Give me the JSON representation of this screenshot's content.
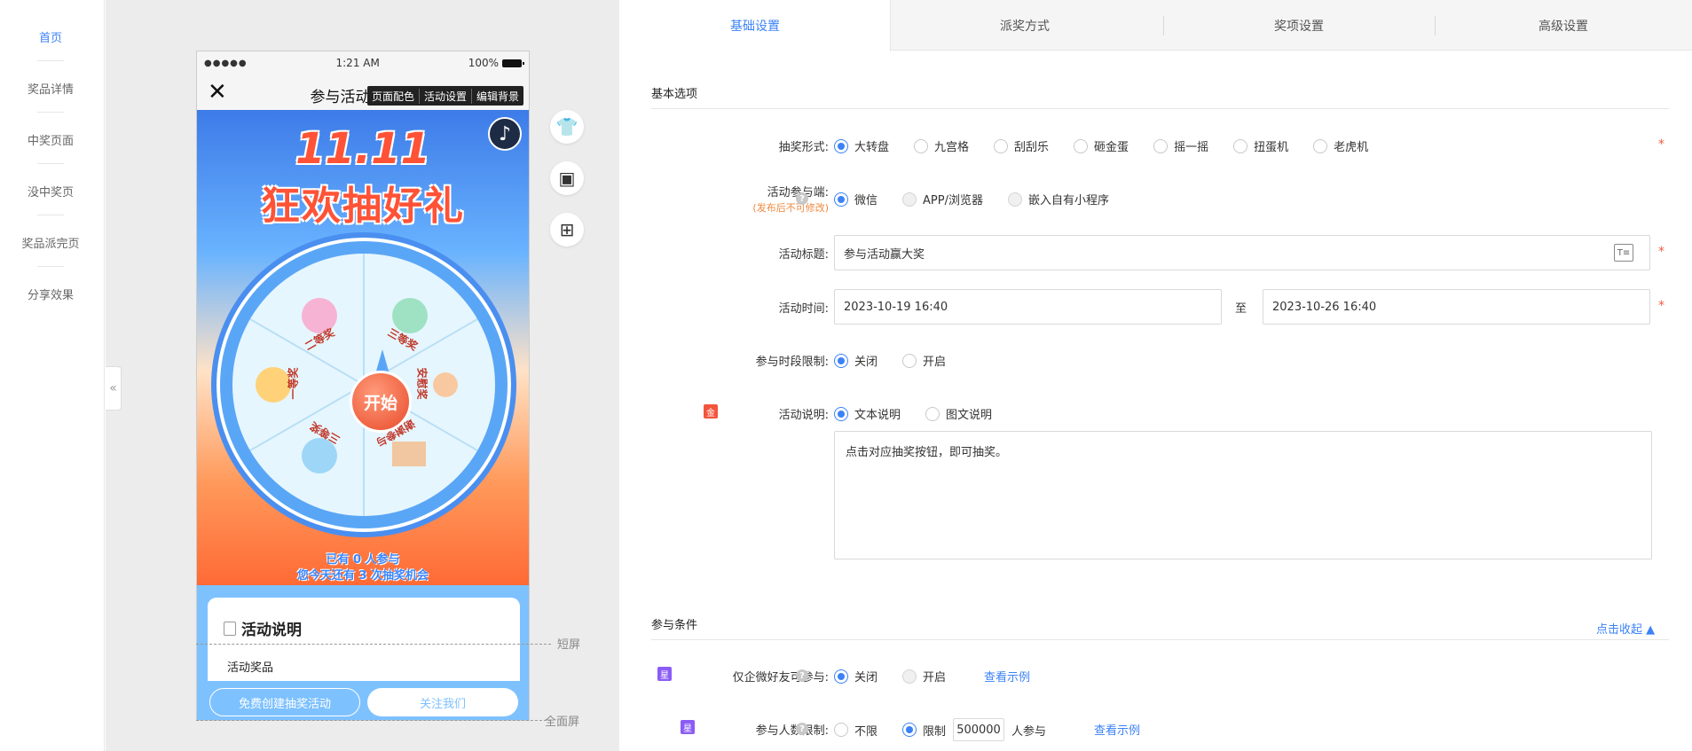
{
  "sidebar": {
    "items": [
      {
        "label": "首页"
      },
      {
        "label": "奖品详情"
      },
      {
        "label": "中奖页面"
      },
      {
        "label": "没中奖页"
      },
      {
        "label": "奖品派完页"
      },
      {
        "label": "分享效果"
      }
    ],
    "collapse_icon": "«"
  },
  "phone": {
    "status": {
      "signal": "●●●●●",
      "time": "1:21 AM",
      "battery": "100%"
    },
    "title": "参与活动赢大奖",
    "floating_menu": [
      "页面配色",
      "活动设置",
      "编辑背景"
    ],
    "hero": {
      "title_line1": "11.11",
      "title_line2": "狂欢抽好礼",
      "start_label": "开始",
      "prizes": [
        "二等奖",
        "三等奖",
        "安慰奖",
        "谢谢参与",
        "三等奖",
        "一等奖"
      ],
      "participants_note": "已有 0 人参与",
      "chances_note": "您今天还有 3 次抽奖机会"
    },
    "description": {
      "heading": "活动说明",
      "subheading": "活动奖品"
    },
    "buttons": {
      "create": "免费创建抽奖活动",
      "follow": "关注我们"
    }
  },
  "screen_labels": {
    "short": "短屏",
    "full": "全面屏"
  },
  "tabs": [
    "基础设置",
    "派奖方式",
    "奖项设置",
    "高级设置"
  ],
  "basic_section": {
    "title": "基本选项",
    "lottery_form": {
      "label": "抽奖形式:",
      "options": [
        "大转盘",
        "九宫格",
        "刮刮乐",
        "砸金蛋",
        "摇一摇",
        "扭蛋机",
        "老虎机"
      ],
      "selected": "大转盘"
    },
    "platform": {
      "label": "活动参与端:",
      "note": "(发布后不可修改)",
      "options": [
        "微信",
        "APP/浏览器",
        "嵌入自有小程序"
      ],
      "selected": "微信"
    },
    "title_field": {
      "label": "活动标题:",
      "value": "参与活动赢大奖"
    },
    "time": {
      "label": "活动时间:",
      "start": "2023-10-19 16:40",
      "sep": "至",
      "end": "2023-10-26 16:40"
    },
    "period_limit": {
      "label": "参与时段限制:",
      "options": [
        "关闭",
        "开启"
      ],
      "selected": "关闭"
    },
    "explanation": {
      "label": "活动说明:",
      "badge": "金",
      "options": [
        "文本说明",
        "图文说明"
      ],
      "selected": "文本说明",
      "text": "点击对应抽奖按钮，即可抽奖。"
    }
  },
  "conditions_section": {
    "title": "参与条件",
    "collapse_link": "点击收起",
    "wecom_friends": {
      "badge": "星",
      "label": "仅企微好友可参与:",
      "options": [
        "关闭",
        "开启"
      ],
      "selected": "关闭",
      "example_link": "查看示例"
    },
    "participant_limit": {
      "badge": "星",
      "label": "参与人数限制:",
      "options": [
        "不限",
        "限制"
      ],
      "selected": "限制",
      "value": "500000",
      "suffix": "人参与",
      "example_link": "查看示例"
    }
  },
  "colors": {
    "accent": "#3b82f6",
    "required": "#f25c3c",
    "badge_gold": "#f2543c",
    "badge_star": "#8b5cf6"
  }
}
